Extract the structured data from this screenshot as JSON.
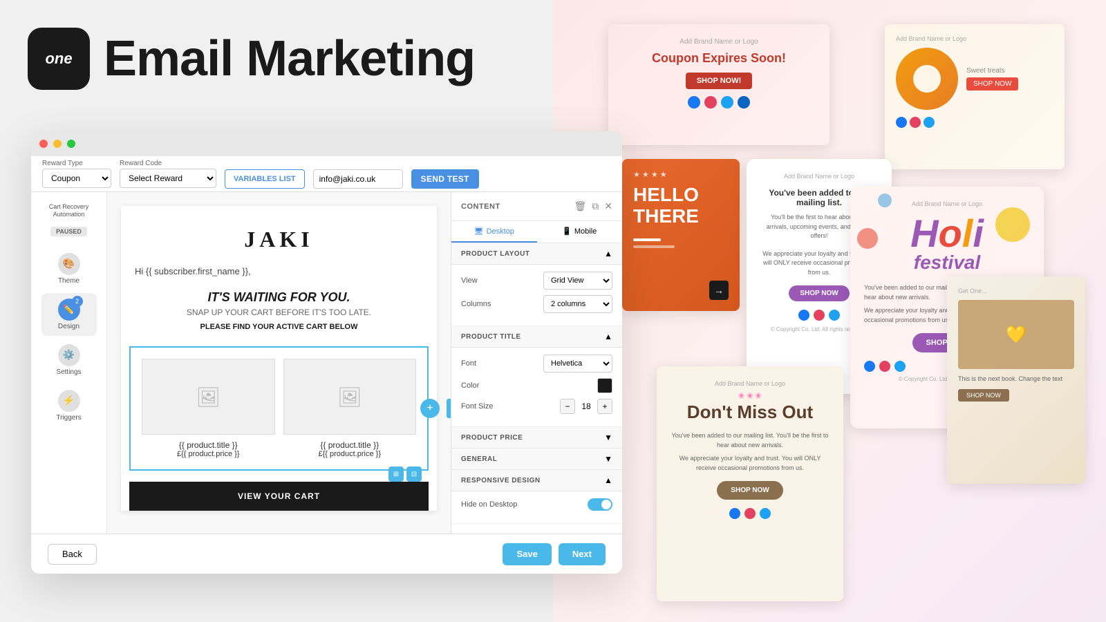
{
  "app": {
    "logo_text": "one",
    "title": "Email Marketing"
  },
  "header": {
    "dots": [
      "red",
      "yellow",
      "green"
    ]
  },
  "toolbar": {
    "reward_type_label": "Reward Type",
    "reward_type_value": "Coupon",
    "reward_code_label": "Reward Code",
    "reward_code_placeholder": "Select Reward",
    "variables_list_label": "VARIABLES LIST",
    "email_value": "info@jaki.co.uk",
    "send_test_label": "SEND teSt"
  },
  "sidebar": {
    "cart_recovery_label": "Cart Recovery\nAutomation",
    "paused_badge": "PAUSED",
    "nav_items": [
      {
        "id": "theme",
        "label": "Theme",
        "icon": "🎨",
        "active": false
      },
      {
        "id": "design",
        "label": "Design",
        "icon": "✏️",
        "active": true,
        "badge": "2"
      },
      {
        "id": "settings",
        "label": "Settings",
        "icon": "⚙️",
        "active": false
      },
      {
        "id": "triggers",
        "label": "Triggers",
        "icon": "⚡",
        "active": false
      }
    ]
  },
  "email_preview": {
    "brand_name": "JAKI",
    "greeting": "Hi {{ subscriber.first_name }},",
    "hero_title": "IT'S WAITING FOR YOU.",
    "hero_subtitle": "SNAP UP YOUR CART BEFORE IT'S TOO LATE.",
    "find_cart_text": "PLEASE FIND YOUR ACTIVE CART BELOW",
    "products": [
      {
        "title": "{{ product.title }}",
        "price": "£{{ product.price }}"
      },
      {
        "title": "{{ product.title }}",
        "price": "£{{ product.price }}"
      }
    ],
    "cta_button": "VIEW YOUR CART"
  },
  "right_panel": {
    "header_title": "CONTENT",
    "tabs": [
      {
        "label": "Desktop",
        "icon": "🖥",
        "active": true
      },
      {
        "label": "Mobile",
        "icon": "📱",
        "active": false
      }
    ],
    "sections": [
      {
        "id": "product_layout",
        "title": "PRODUCT LAYOUT",
        "expanded": true,
        "fields": [
          {
            "label": "View",
            "type": "select",
            "value": "Grid View"
          },
          {
            "label": "Columns",
            "type": "select",
            "value": "2 columns"
          }
        ]
      },
      {
        "id": "product_title",
        "title": "PRODUCT TITLE",
        "expanded": true,
        "fields": [
          {
            "label": "Font",
            "type": "select",
            "value": "Helvetica"
          },
          {
            "label": "Color",
            "type": "color",
            "value": "#1a1a1a"
          },
          {
            "label": "Font Size",
            "type": "stepper",
            "value": "18"
          }
        ]
      },
      {
        "id": "product_price",
        "title": "PRODUCT PRICE",
        "expanded": false
      },
      {
        "id": "general",
        "title": "GENERAL",
        "expanded": false
      },
      {
        "id": "responsive_design",
        "title": "RESPONSIVE DESIGN",
        "expanded": true,
        "fields": [
          {
            "label": "Hide on Desktop",
            "type": "toggle",
            "value": true
          }
        ]
      }
    ]
  },
  "bottom_nav": {
    "back_label": "Back",
    "save_label": "Save",
    "next_label": "Next"
  },
  "collage": {
    "holi_title": "Holi\nfestival",
    "shop_now": "SHOP NOW",
    "coupon_expires": "Coupon Expires Soon!",
    "dont_miss_out": "Don't Miss Out",
    "hello_there": "HELLO THERE"
  }
}
